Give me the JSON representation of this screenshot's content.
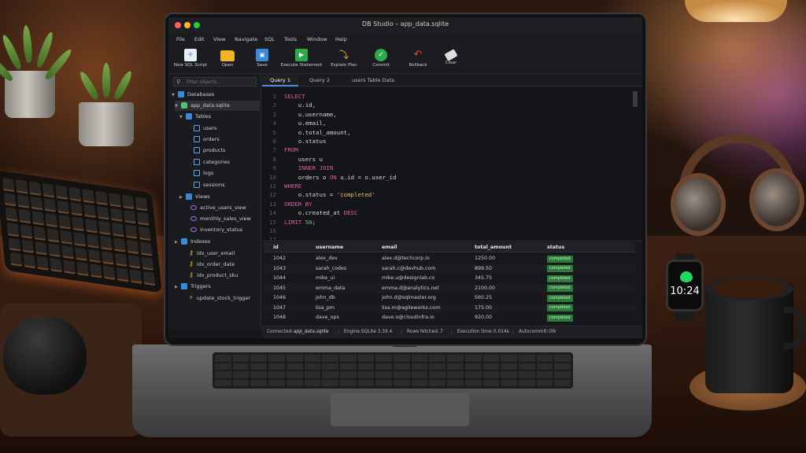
{
  "window": {
    "title": "DB Studio – app_data.sqlite"
  },
  "menu": [
    "File",
    "Edit",
    "View",
    "Navigate",
    "SQL",
    "Tools",
    "Window",
    "Help"
  ],
  "toolbar": [
    {
      "label": "New SQL Script",
      "icon": "new-file-icon",
      "color": "#4a90e2"
    },
    {
      "label": "Open",
      "icon": "folder-icon",
      "color": "#f0b429"
    },
    {
      "label": "Save",
      "icon": "save-icon",
      "color": "#3b8ad9"
    },
    {
      "label": "Execute Statement",
      "icon": "play-icon",
      "color": "#2eaa4a"
    },
    {
      "label": "Explain Plan",
      "icon": "explain-icon",
      "color": "#f0b429"
    },
    {
      "label": "Commit",
      "icon": "check-icon",
      "color": "#2eaa4a"
    },
    {
      "label": "Rollback",
      "icon": "undo-icon",
      "color": "#e04545"
    },
    {
      "label": "Clear",
      "icon": "eraser-icon",
      "color": "#dddddd"
    }
  ],
  "sidebar": {
    "search_placeholder": "Filter objects...",
    "databases_label": "Databases",
    "db_name": "app_data.sqlite",
    "tables_label": "Tables",
    "tables": [
      "users",
      "orders",
      "products",
      "categories",
      "logs",
      "sessions"
    ],
    "views_label": "Views",
    "views": [
      "active_users_view",
      "monthly_sales_view",
      "inventory_status"
    ],
    "indexes_label": "Indexes",
    "indexes": [
      "idx_user_email",
      "idx_order_date",
      "idx_product_sku"
    ],
    "triggers_label": "Triggers",
    "triggers": [
      "update_stock_trigger"
    ]
  },
  "tabs": [
    {
      "label": "Query 1",
      "active": true
    },
    {
      "label": "Query 2",
      "active": false
    },
    {
      "label": "users Table Data",
      "active": false
    }
  ],
  "editor": {
    "line_numbers": [
      "1",
      "2",
      "3",
      "4",
      "5",
      "6",
      "7",
      "8",
      "9",
      "10",
      "11",
      "12",
      "13",
      "14",
      "15",
      "16",
      "17"
    ]
  },
  "results": {
    "columns": [
      "id",
      "username",
      "email",
      "total_amount",
      "status"
    ],
    "rows": [
      {
        "id": "1042",
        "username": "alex_dev",
        "email": "alex.d@techcorp.io",
        "total_amount": "1250.00",
        "status": "completed"
      },
      {
        "id": "1043",
        "username": "sarah_codes",
        "email": "sarah.c@devhub.com",
        "total_amount": "899.50",
        "status": "completed"
      },
      {
        "id": "1044",
        "username": "mike_ui",
        "email": "mike.u@designlab.co",
        "total_amount": "345.75",
        "status": "completed"
      },
      {
        "id": "1045",
        "username": "emma_data",
        "email": "emma.d@analytics.net",
        "total_amount": "2100.00",
        "status": "completed"
      },
      {
        "id": "1046",
        "username": "john_db",
        "email": "john.d@sqlmaster.org",
        "total_amount": "560.25",
        "status": "completed"
      },
      {
        "id": "1047",
        "username": "lisa_pm",
        "email": "lisa.m@agileworks.com",
        "total_amount": "175.00",
        "status": "completed"
      },
      {
        "id": "1048",
        "username": "dave_ops",
        "email": "dave.o@cloudinfra.io",
        "total_amount": "920.00",
        "status": "completed"
      }
    ]
  },
  "statusbar": {
    "connected_label": "Connected:",
    "connected_value": "app_data.sqlite",
    "engine_label": "Engine:",
    "engine_value": "SQLite 3.39.4",
    "rows_label": "Rows fetched:",
    "rows_value": "7",
    "time_label": "Execution time:",
    "time_value": "0.014s",
    "autocommit_label": "Autocommit:",
    "autocommit_value": "ON"
  },
  "watch": {
    "time": "10:24"
  },
  "colors": {
    "keyword": "#e05aa8",
    "string": "#e6c36b",
    "badge": "#2d7a3a",
    "accent": "#4a90e2"
  }
}
